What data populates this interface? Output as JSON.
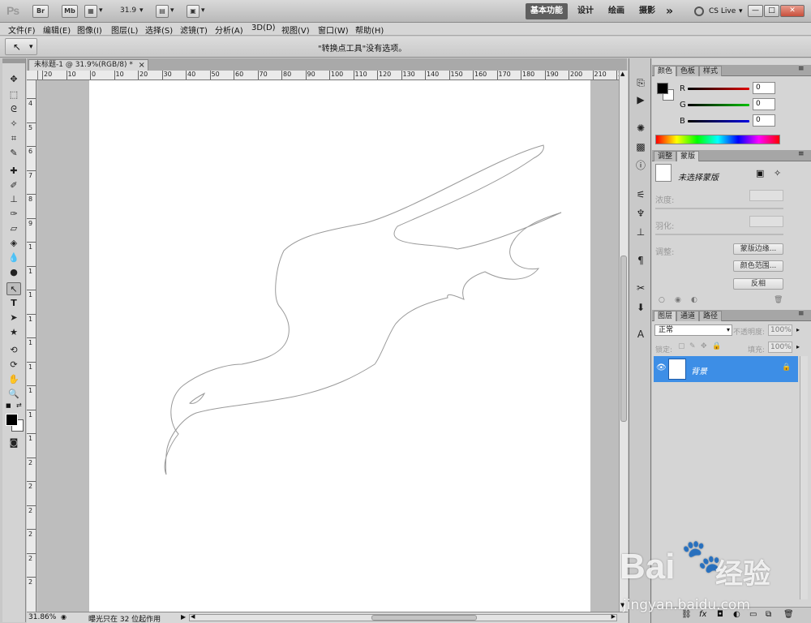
{
  "app": {
    "logo": "Ps",
    "bridge_label": "Br",
    "minibridge_label": "Mb",
    "zoom_dropdown": "31.9",
    "workspaces": [
      "基本功能",
      "设计",
      "绘画",
      "摄影"
    ],
    "workspace_more": "»",
    "cs_live": "CS Live",
    "window_buttons": [
      "—",
      "□",
      "✕"
    ]
  },
  "menu": [
    "文件(F)",
    "编辑(E)",
    "图像(I)",
    "图层(L)",
    "选择(S)",
    "滤镜(T)",
    "分析(A)",
    "3D(D)",
    "视图(V)",
    "窗口(W)",
    "帮助(H)"
  ],
  "options_bar": {
    "message": "\"转换点工具\"没有选项。"
  },
  "document": {
    "tab_title": "未标题-1 @ 31.9%(RGB/8) *",
    "close_symbol": "×",
    "ruler_h_ticks": [
      "20",
      "10",
      "0",
      "10",
      "20",
      "30",
      "40",
      "50",
      "60",
      "70",
      "80",
      "90",
      "100",
      "110",
      "120",
      "130",
      "140",
      "150",
      "160",
      "170",
      "180",
      "190",
      "200",
      "210",
      "2"
    ],
    "ruler_v_ticks": [
      "4",
      "5",
      "6",
      "7",
      "8",
      "9",
      "1",
      "1",
      "1",
      "1",
      "1",
      "1",
      "1",
      "1",
      "1",
      "2",
      "2",
      "2",
      "2",
      "2",
      "2"
    ]
  },
  "status": {
    "zoom": "31.86%",
    "info": "曝光只在 32 位起作用"
  },
  "color_panel": {
    "tabs": [
      "颜色",
      "色板",
      "样式"
    ],
    "r_label": "R",
    "g_label": "G",
    "b_label": "B",
    "r_value": "0",
    "g_value": "0",
    "b_value": "0",
    "colors": {
      "red": "#cc0000",
      "green": "#00aa00",
      "blue": "#0000cc",
      "foreground": "#000000",
      "background": "#ffffff"
    }
  },
  "masks_panel": {
    "tabs": [
      "调整",
      "蒙版"
    ],
    "no_mask": "未选择蒙版",
    "density_label": "浓度:",
    "feather_label": "羽化:",
    "refine_label": "调整:",
    "buttons": [
      "蒙版边缘...",
      "颜色范围...",
      "反相"
    ]
  },
  "layers_panel": {
    "tabs": [
      "图层",
      "通道",
      "路径"
    ],
    "blend_mode": "正常",
    "opacity_label": "不透明度:",
    "opacity_value": "100%",
    "lock_label": "锁定:",
    "fill_label": "填充:",
    "fill_value": "100%",
    "layer_name": "背景",
    "selected_color": "#3d8ee6"
  },
  "watermark": {
    "brand": "Bai",
    "brand_tail": "经验",
    "url": "jingyan.baidu.com"
  }
}
